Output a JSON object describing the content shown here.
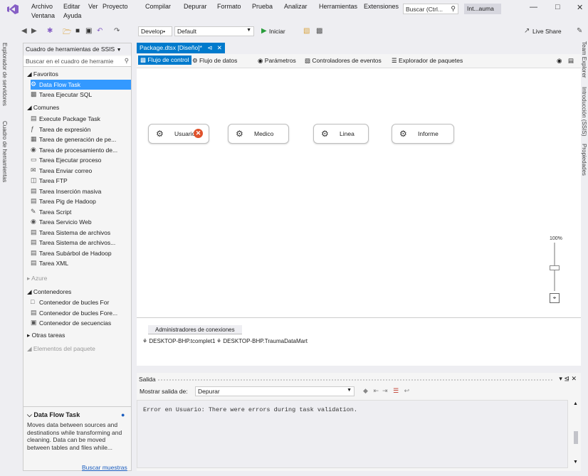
{
  "menu": {
    "items": [
      "Archivo",
      "Editar",
      "Ver",
      "Proyecto",
      "Compilar",
      "Depurar",
      "Formato",
      "Prueba",
      "Analizar",
      "Herramientas",
      "Extensiones"
    ],
    "row2": [
      "Ventana",
      "Ayuda"
    ],
    "search_placeholder": "Buscar (Ctrl...",
    "profile": "Int...auma"
  },
  "toolbar": {
    "config": "Develop•",
    "platform": "Default",
    "start": "Iniciar",
    "live_share": "Live Share"
  },
  "left_rail": {
    "server_explorer": "Explorador de servidores",
    "toolbox": "Cuadro de herramientas"
  },
  "right_rail": {
    "team_explorer": "Team Explorer",
    "intro": "Introducción (SSIS)",
    "properties": "Propiedades"
  },
  "toolbox": {
    "title": "Cuadro de herramientas de SSIS",
    "search_placeholder": "Buscar en el cuadro de herramie",
    "groups": {
      "favoritos": "◢ Favoritos",
      "comunes": "◢ Comunes",
      "azure": "▸ Azure",
      "contenedores": "◢ Contenedores",
      "otras": "▸ Otras tareas",
      "elementos": "◢ Elementos del paquete"
    },
    "favoritos": [
      "Data Flow Task",
      "Tarea Ejecutar SQL"
    ],
    "comunes": [
      "Execute Package Task",
      "Tarea de expresión",
      "Tarea de generación de pe...",
      "Tarea de procesamiento de...",
      "Tarea Ejecutar proceso",
      "Tarea Enviar correo",
      "Tarea FTP",
      "Tarea Inserción masiva",
      "Tarea Pig de Hadoop",
      "Tarea Script",
      "Tarea Servicio Web",
      "Tarea Sistema de archivos",
      "Tarea Sistema de archivos...",
      "Tarea Subárbol de Hadoop",
      "Tarea XML"
    ],
    "contenedores": [
      "Contenedor de bucles For",
      "Contenedor de bucles Fore...",
      "Contenedor de secuencias"
    ],
    "desc_title": "Data Flow Task",
    "desc_text": "Moves data between sources and destinations while transforming and cleaning. Data can be moved between tables and files while...",
    "desc_link": "Buscar muestras"
  },
  "document": {
    "tab": "Package.dtsx [Diseño]*",
    "designer_tabs": [
      "Flujo de control",
      "Flujo de datos",
      "Parámetros",
      "Controladores de eventos",
      "Explorador de paquetes"
    ]
  },
  "canvas": {
    "tasks": [
      {
        "label": "Usuario",
        "error": true
      },
      {
        "label": "Medico",
        "error": false
      },
      {
        "label": "Linea",
        "error": false
      },
      {
        "label": "Informe",
        "error": false
      }
    ],
    "zoom": "100%"
  },
  "connections": {
    "tab": "Administradores de conexiones",
    "items": [
      "DESKTOP-BHP.tcomplet1",
      "DESKTOP-BHP.TraumaDataMart"
    ]
  },
  "output": {
    "title": "Salida",
    "source_label": "Mostrar salida de:",
    "source_value": "Depurar",
    "message": "Error en Usuario: There were errors during task validation."
  }
}
